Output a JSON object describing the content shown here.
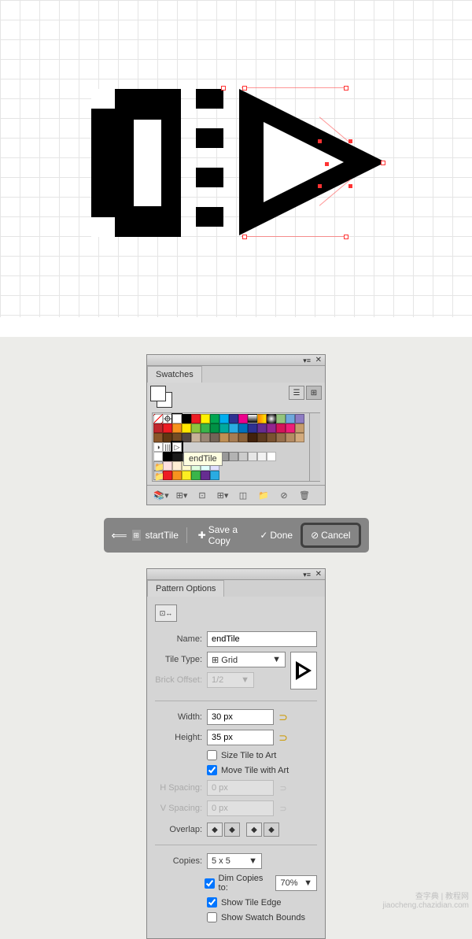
{
  "canvas": {},
  "swatches": {
    "tab": "Swatches",
    "tooltip": "endTile",
    "rows": [
      [
        "#fff",
        "#fff",
        "#000",
        "#fff",
        "#ff0000",
        "#ffff00",
        "#00ff00",
        "#00ffff",
        "#0000ff",
        "#ff00ff",
        "#8b4a1e",
        "#ff7f00",
        "#bfff00",
        "#00ff80",
        "#0080ff",
        "#8000ff"
      ],
      [
        "#ff8080",
        "#ffc080",
        "#ffff80",
        "#c0ff80",
        "#80ff80",
        "#80ffc0",
        "#80ffff",
        "#80c0ff",
        "#8080ff",
        "#c080ff",
        "#ff80ff",
        "#ff80c0",
        "#c0c0c0",
        "#a0a0a0",
        "#808080",
        "#606060"
      ],
      [
        "#800000",
        "#804000",
        "#808000",
        "#408000",
        "#008000",
        "#008040",
        "#008080",
        "#004080",
        "#000080",
        "#400080",
        "#800080",
        "#5c3a21",
        "#7b5a3b",
        "#9b7b56",
        "#b89c78",
        "#d6bf9b"
      ],
      [
        "tile1",
        "tile2",
        "tile3",
        "",
        "",
        "",
        "",
        "",
        "",
        "",
        "",
        "",
        "",
        "",
        "",
        ""
      ],
      [
        "folder",
        "#fff",
        "#ffc0c0",
        "#ffe0c0",
        "#ffffc0",
        "#e0ffc0",
        "#c0ffc0",
        "",
        "",
        "",
        "",
        "",
        "",
        "",
        "",
        ""
      ],
      [
        "folder",
        "#ff3333",
        "#33ff33",
        "#3333ff",
        "#ffff33",
        "#ff33ff",
        "#33ffff",
        "",
        "",
        "",
        "",
        "",
        "",
        "",
        "",
        ""
      ]
    ],
    "grays": [
      "#000",
      "#1a1a1a",
      "#333",
      "#4d4d4d",
      "#666",
      "#808080",
      "#999",
      "#b3b3b3",
      "#ccc",
      "#e6e6e6",
      "#fff"
    ]
  },
  "actionbar": {
    "preset": "startTile",
    "save": "Save a Copy",
    "done": "Done",
    "cancel": "Cancel"
  },
  "pattern": {
    "tab": "Pattern Options",
    "name_label": "Name:",
    "name_value": "endTile",
    "tiletype_label": "Tile Type:",
    "tiletype_value": "Grid",
    "brick_label": "Brick Offset:",
    "brick_value": "1/2",
    "width_label": "Width:",
    "width_value": "30 px",
    "height_label": "Height:",
    "height_value": "35 px",
    "size_to_art": "Size Tile to Art",
    "move_with_art": "Move Tile with Art",
    "hspacing_label": "H Spacing:",
    "hspacing_value": "0 px",
    "vspacing_label": "V Spacing:",
    "vspacing_value": "0 px",
    "overlap_label": "Overlap:",
    "copies_label": "Copies:",
    "copies_value": "5 x 5",
    "dim_to": "Dim Copies to:",
    "dim_value": "70%",
    "show_edge": "Show Tile Edge",
    "show_swatch": "Show Swatch Bounds"
  },
  "watermark": {
    "line1": "查字典 | 教程网",
    "line2": "jiaocheng.chazidian.com"
  }
}
